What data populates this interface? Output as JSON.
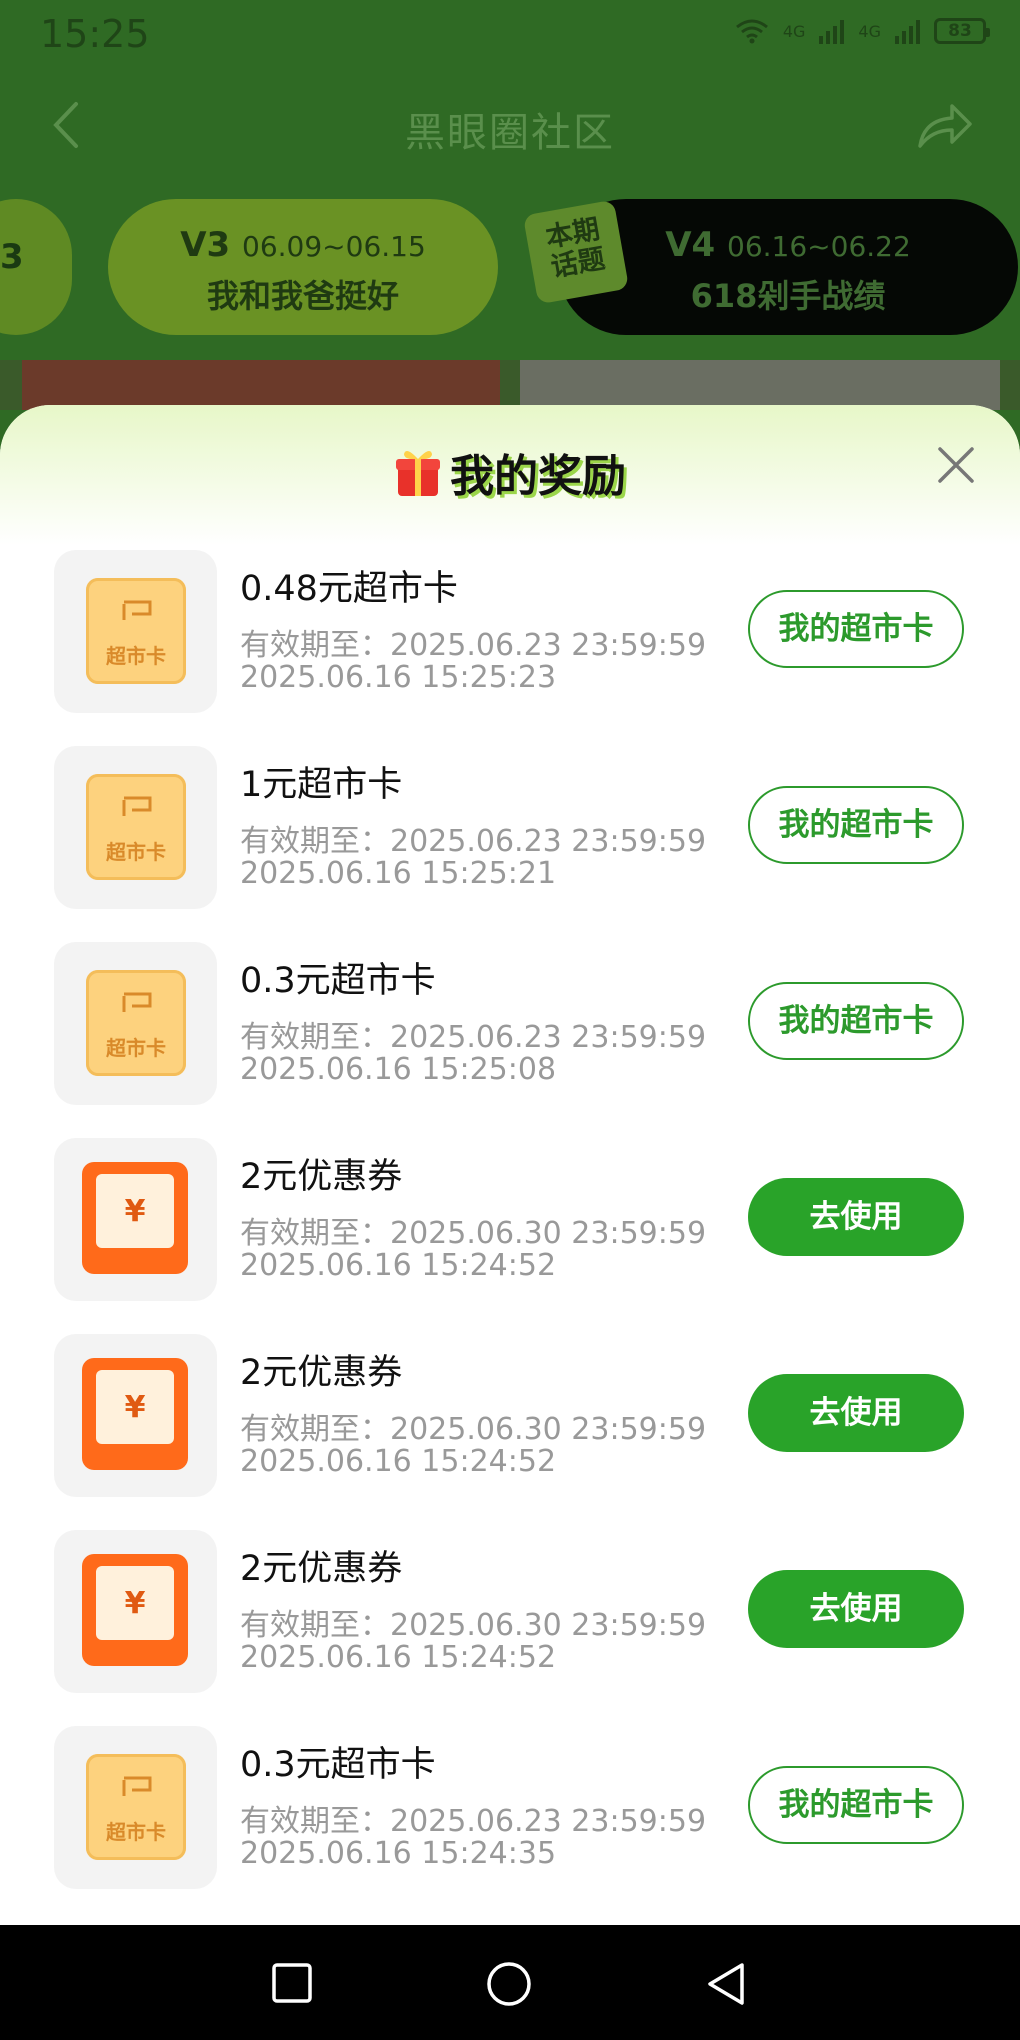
{
  "status": {
    "time": "15:25",
    "battery": "83",
    "net1": "4G",
    "net2": "4G"
  },
  "header": {
    "title": "黑眼圈社区"
  },
  "tabs": {
    "prev_fragment": "3",
    "v3_code": "V3",
    "v3_dates": "06.09~06.15",
    "v3_topic": "我和我爸挺好",
    "badge_line1": "本期",
    "badge_line2": "话题",
    "v4_code": "V4",
    "v4_dates": "06.16~06.22",
    "v4_topic": "618剁手战绩"
  },
  "modal": {
    "title": "我的奖励"
  },
  "rewards": [
    {
      "type": "supermarket",
      "icon_label": "超市卡",
      "name": "0.48元超市卡",
      "expiry": "有效期至：2025.06.23 23:59:59",
      "date": "2025.06.16 15:25:23",
      "action": "我的超市卡"
    },
    {
      "type": "supermarket",
      "icon_label": "超市卡",
      "name": "1元超市卡",
      "expiry": "有效期至：2025.06.23 23:59:59",
      "date": "2025.06.16 15:25:21",
      "action": "我的超市卡"
    },
    {
      "type": "supermarket",
      "icon_label": "超市卡",
      "name": "0.3元超市卡",
      "expiry": "有效期至：2025.06.23 23:59:59",
      "date": "2025.06.16 15:25:08",
      "action": "我的超市卡"
    },
    {
      "type": "coupon",
      "icon_label": "¥",
      "name": "2元优惠券",
      "expiry": "有效期至：2025.06.30 23:59:59",
      "date": "2025.06.16 15:24:52",
      "action": "去使用"
    },
    {
      "type": "coupon",
      "icon_label": "¥",
      "name": "2元优惠券",
      "expiry": "有效期至：2025.06.30 23:59:59",
      "date": "2025.06.16 15:24:52",
      "action": "去使用"
    },
    {
      "type": "coupon",
      "icon_label": "¥",
      "name": "2元优惠券",
      "expiry": "有效期至：2025.06.30 23:59:59",
      "date": "2025.06.16 15:24:52",
      "action": "去使用"
    },
    {
      "type": "supermarket",
      "icon_label": "超市卡",
      "name": "0.3元超市卡",
      "expiry": "有效期至：2025.06.23 23:59:59",
      "date": "2025.06.16 15:24:35",
      "action": "我的超市卡"
    }
  ],
  "colors": {
    "header_bg": "#2f6a24",
    "accent_green": "#29a329",
    "coupon_orange": "#ff6a1a",
    "card_gold": "#fdd27e"
  }
}
